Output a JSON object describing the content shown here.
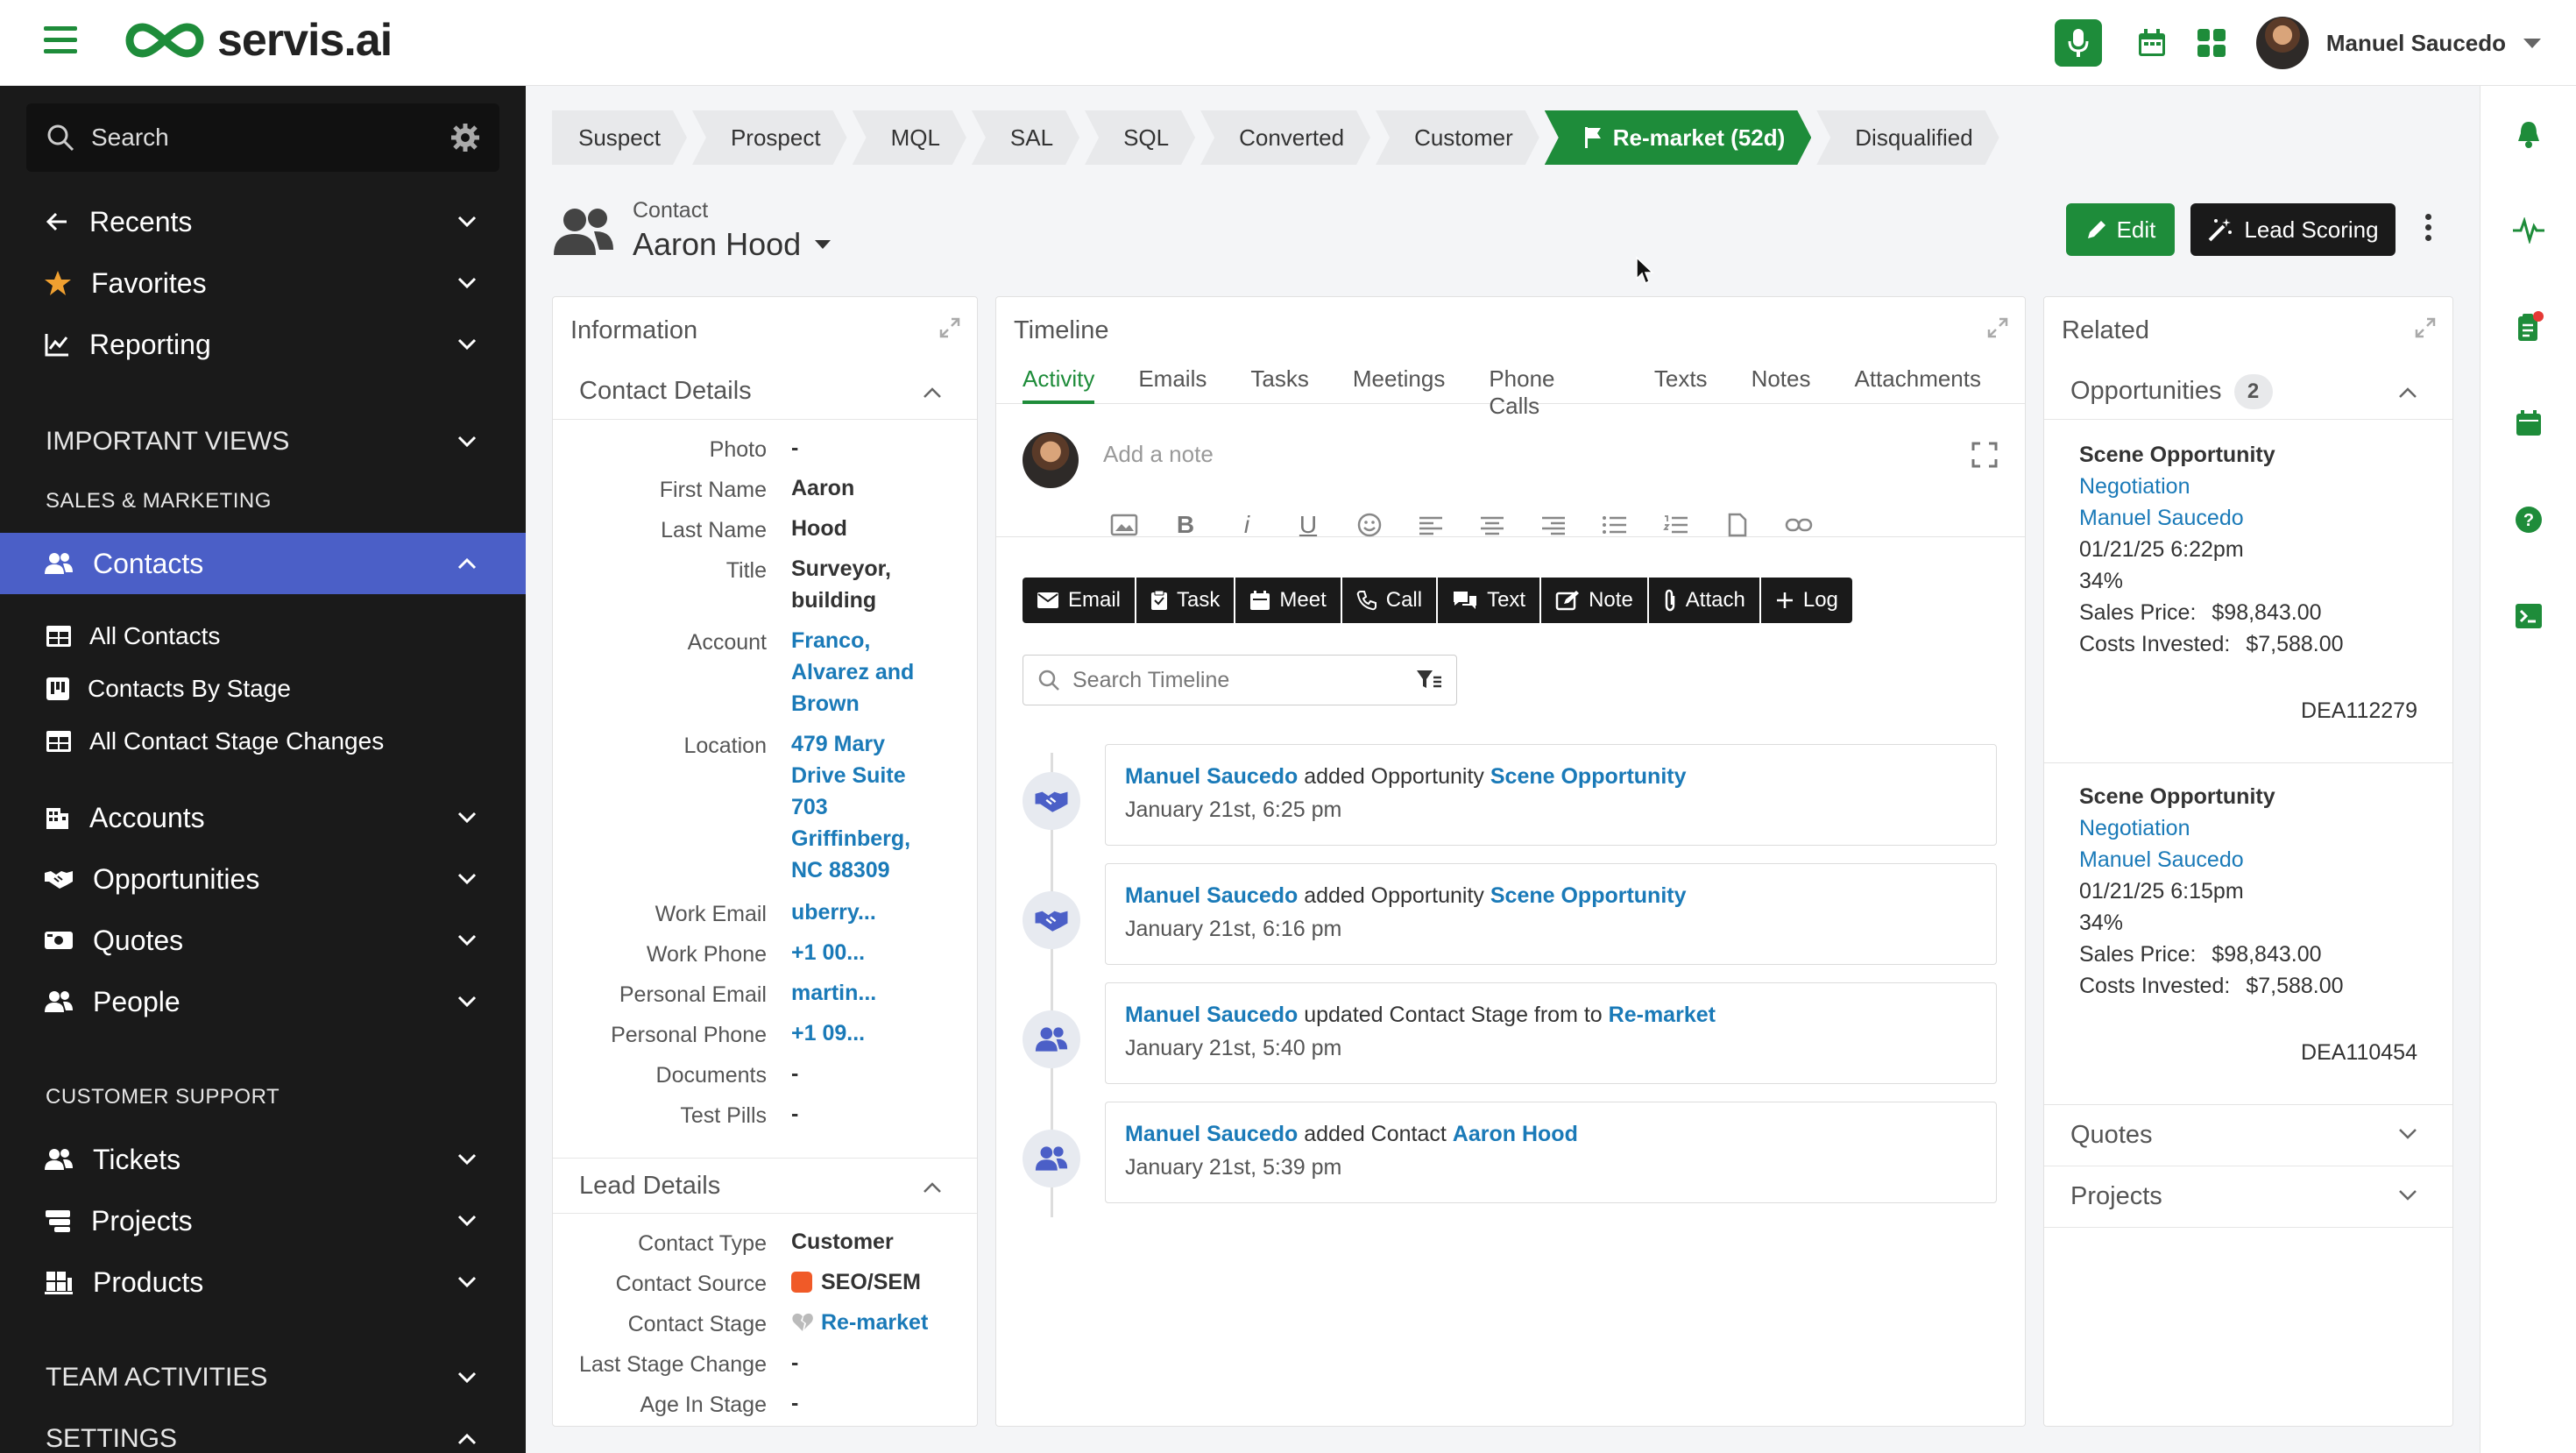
{
  "app": {
    "logo_text": "servis.ai"
  },
  "topbar": {
    "user_name": "Manuel Saucedo"
  },
  "sidebar": {
    "search_label": "Search",
    "recents": "Recents",
    "favorites": "Favorites",
    "reporting": "Reporting",
    "important_views": "IMPORTANT VIEWS",
    "sales_marketing": "SALES & MARKETING",
    "contacts": "Contacts",
    "all_contacts": "All Contacts",
    "contacts_by_stage": "Contacts By Stage",
    "all_contact_stage_changes": "All Contact Stage Changes",
    "accounts": "Accounts",
    "opportunities": "Opportunities",
    "quotes": "Quotes",
    "people": "People",
    "customer_support": "CUSTOMER SUPPORT",
    "tickets": "Tickets",
    "projects": "Projects",
    "products": "Products",
    "team_activities": "TEAM ACTIVITIES",
    "settings": "SETTINGS"
  },
  "stages": [
    "Suspect",
    "Prospect",
    "MQL",
    "SAL",
    "SQL",
    "Converted",
    "Customer",
    "Re-market (52d)",
    "Disqualified"
  ],
  "header": {
    "type_label": "Contact",
    "name": "Aaron Hood",
    "edit_label": "Edit",
    "lead_scoring_label": "Lead Scoring"
  },
  "information": {
    "title": "Information",
    "contact_details_title": "Contact Details",
    "fields": [
      {
        "label": "Photo",
        "value": "-"
      },
      {
        "label": "First Name",
        "value": "Aaron"
      },
      {
        "label": "Last Name",
        "value": "Hood"
      },
      {
        "label": "Title",
        "value": "Surveyor, building"
      },
      {
        "label": "Account",
        "value": "Franco, Alvarez and Brown"
      },
      {
        "label": "Location",
        "value": "479 Mary Drive Suite 703 Griffinberg, NC 88309"
      },
      {
        "label": "Work Email",
        "value": "uberry..."
      },
      {
        "label": "Work Phone",
        "value": "+1 00..."
      },
      {
        "label": "Personal Email",
        "value": "martin..."
      },
      {
        "label": "Personal Phone",
        "value": "+1 09..."
      },
      {
        "label": "Documents",
        "value": "-"
      },
      {
        "label": "Test Pills",
        "value": "-"
      }
    ],
    "lead_details_title": "Lead Details",
    "lead_fields": [
      {
        "label": "Contact Type",
        "value": "Customer"
      },
      {
        "label": "Contact Source",
        "value": "SEO/SEM"
      },
      {
        "label": "Contact Stage",
        "value": "Re-market"
      },
      {
        "label": "Last Stage Change",
        "value": "-"
      },
      {
        "label": "Age In Stage",
        "value": "-"
      }
    ]
  },
  "timeline": {
    "title": "Timeline",
    "tabs": [
      "Activity",
      "Emails",
      "Tasks",
      "Meetings",
      "Phone Calls",
      "Texts",
      "Notes",
      "Attachments"
    ],
    "note_placeholder": "Add a note",
    "actions": [
      "Email",
      "Task",
      "Meet",
      "Call",
      "Text",
      "Note",
      "Attach",
      "Log"
    ],
    "search_placeholder": "Search Timeline",
    "entries": [
      {
        "actor": "Manuel Saucedo",
        "action": "added Opportunity",
        "target": "Scene Opportunity",
        "time": "January 21st, 6:25 pm",
        "icon": "handshake-icon"
      },
      {
        "actor": "Manuel Saucedo",
        "action": "added Opportunity",
        "target": "Scene Opportunity",
        "time": "January 21st, 6:16 pm",
        "icon": "handshake-icon"
      },
      {
        "actor": "Manuel Saucedo",
        "action": "updated Contact Stage from to",
        "target": "Re-market",
        "time": "January 21st, 5:40 pm",
        "icon": "people-icon"
      },
      {
        "actor": "Manuel Saucedo",
        "action": "added Contact",
        "target": "Aaron Hood",
        "time": "January 21st, 5:39 pm",
        "icon": "people-icon"
      }
    ]
  },
  "related": {
    "title": "Related",
    "opportunities_label": "Opportunities",
    "opportunities_count": "2",
    "opportunities": [
      {
        "name": "Scene Opportunity",
        "stage": "Negotiation",
        "owner": "Manuel Saucedo",
        "date": "01/21/25 6:22pm",
        "probability": "34%",
        "sales_price_label": "Sales Price:",
        "sales_price": "$98,843.00",
        "costs_label": "Costs Invested:",
        "costs": "$7,588.00",
        "code": "DEA112279"
      },
      {
        "name": "Scene Opportunity",
        "stage": "Negotiation",
        "owner": "Manuel Saucedo",
        "date": "01/21/25 6:15pm",
        "probability": "34%",
        "sales_price_label": "Sales Price:",
        "sales_price": "$98,843.00",
        "costs_label": "Costs Invested:",
        "costs": "$7,588.00",
        "code": "DEA110454"
      }
    ],
    "quotes_label": "Quotes",
    "projects_label": "Projects"
  }
}
